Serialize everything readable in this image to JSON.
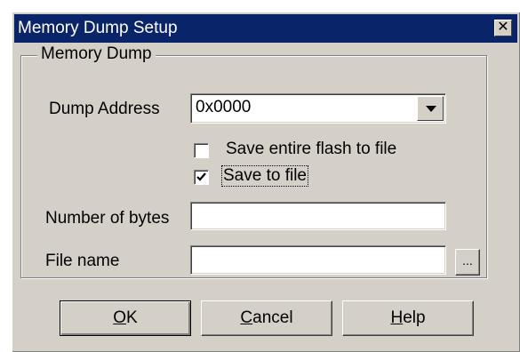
{
  "window": {
    "title": "Memory Dump Setup",
    "close_glyph": "✕"
  },
  "group": {
    "label": "Memory Dump"
  },
  "dump_address": {
    "label": "Dump Address",
    "value": "0x0000"
  },
  "options": {
    "save_entire_flash": {
      "label": "Save entire flash to file",
      "checked": false
    },
    "save_to_file": {
      "label": "Save to file",
      "checked": true
    }
  },
  "number_of_bytes": {
    "label": "Number of bytes",
    "value": ""
  },
  "file_name": {
    "label": "File name",
    "value": "",
    "browse_label": "..."
  },
  "buttons": {
    "ok": {
      "mnemonic": "O",
      "rest": "K"
    },
    "cancel": {
      "mnemonic": "C",
      "rest": "ancel"
    },
    "help": {
      "mnemonic": "H",
      "rest": "elp"
    }
  },
  "colors": {
    "titlebar": "#0a246a",
    "face": "#d4d0c8"
  }
}
